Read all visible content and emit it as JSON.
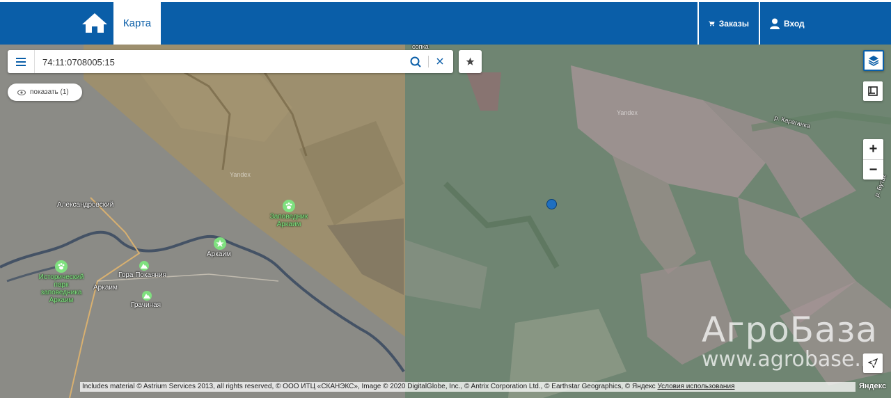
{
  "nav": {
    "tab_label": "Карта",
    "orders_label": "Заказы",
    "login_label": "Вход",
    "brand_color": "#0a5ea8"
  },
  "search": {
    "value": "74:11:0708005:15",
    "placeholder": ""
  },
  "show_button": {
    "label": "показать (1)"
  },
  "map_labels": {
    "sopka": "сопка",
    "aleksandrovsky": "Александровский",
    "arkaim_reserve": "Заповедник Аркаим",
    "arkaim": "Аркаим",
    "gora_pokayaniya": "Гора Покаяния",
    "arkaim_village": "Аркаим",
    "grachinaya": "Грачиная",
    "historical_park": "Исторический парк заповедника Аркаим",
    "karaganka": "р. Караганка",
    "butak": "р. Бутак",
    "yandex_wm_1": "Yandex",
    "yandex_wm_2": "Yandex"
  },
  "watermark": {
    "line1": "АгроБаза",
    "line2": "www.agrobase.ru"
  },
  "copyright": {
    "text": "Includes material © Astrium Services 2013, all rights reserved, © ООО ИТЦ «СКАНЭКС», Image © 2020 DigitalGlobe, Inc., © Antrix Corporation Ltd., © Earthstar Geographics, © Яндекс ",
    "terms_link": "Условия использования",
    "logo": "Яндекс"
  },
  "controls": {
    "zoom_in": "+",
    "zoom_out": "−"
  },
  "icons": [
    "home-icon",
    "cart-icon",
    "user-icon",
    "menu-icon",
    "search-icon",
    "close-icon",
    "star-icon",
    "eye-icon",
    "layers-icon",
    "ruler-icon",
    "locate-icon"
  ]
}
